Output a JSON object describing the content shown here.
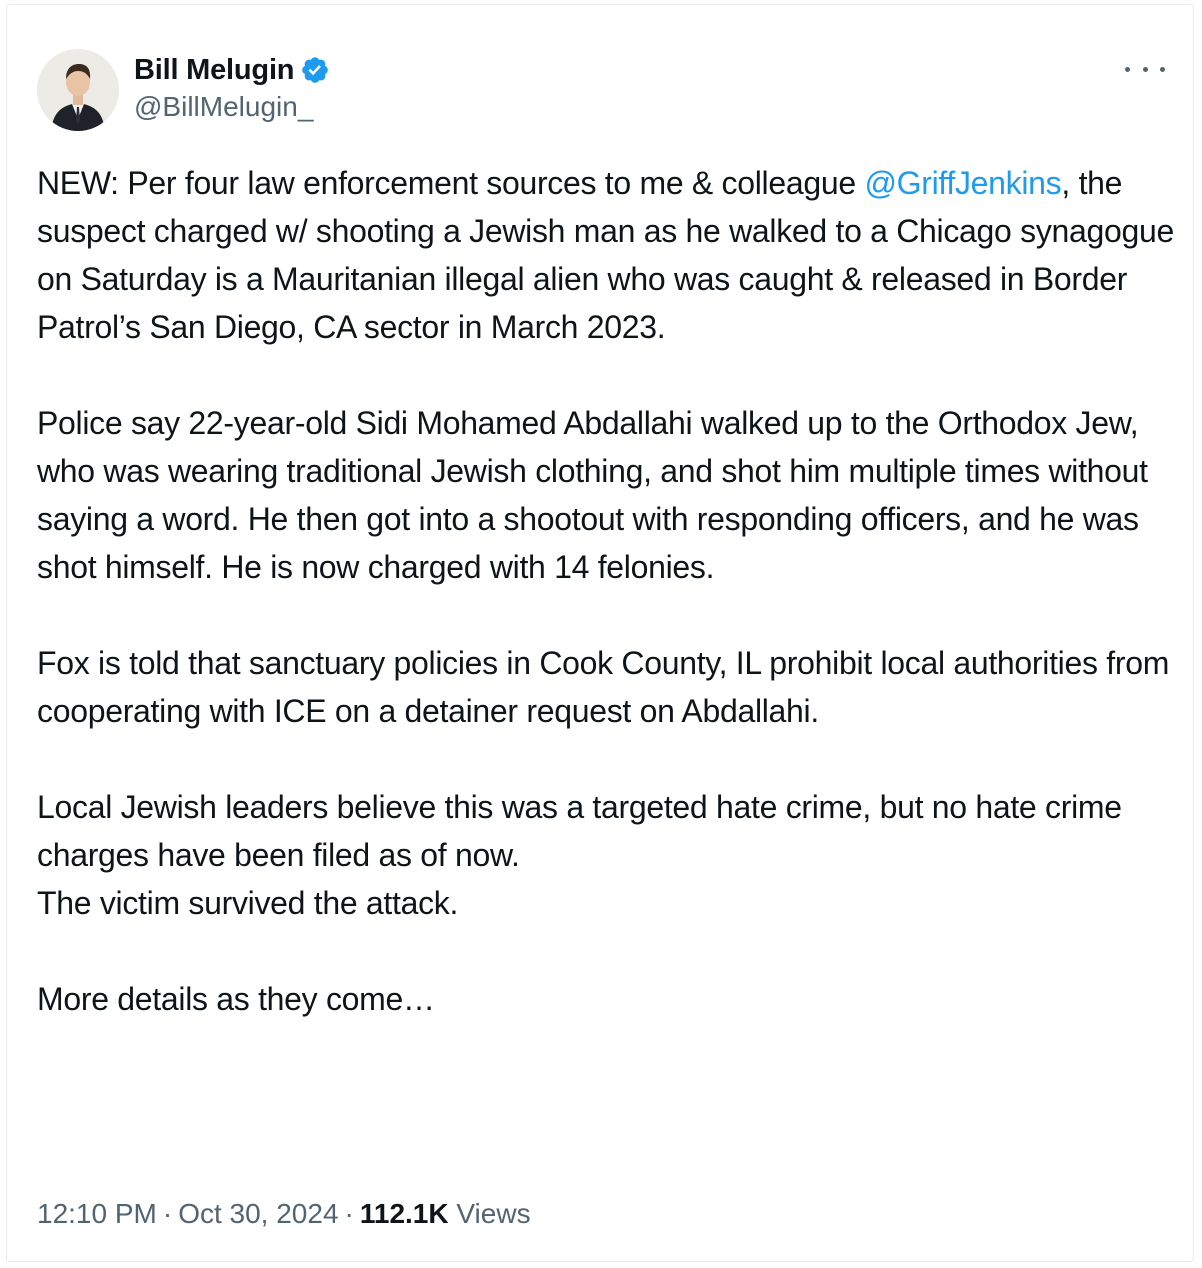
{
  "author": {
    "display_name": "Bill Melugin",
    "handle": "@BillMelugin_",
    "verified": true,
    "verified_color": "#1d9bf0"
  },
  "tweet": {
    "para1_pre": "NEW: Per four law enforcement sources to me & colleague ",
    "para1_mention": "@GriffJenkins",
    "para1_post": ", the suspect charged w/ shooting a Jewish man as he walked to a Chicago synagogue on Saturday is a Mauritanian illegal alien who was caught & released in Border Patrol’s San Diego, CA sector in March 2023.",
    "para2": "Police say 22-year-old Sidi Mohamed Abdallahi walked up to the Orthodox Jew, who was wearing traditional Jewish clothing, and shot him multiple times without saying a word. He then got into a shootout with responding officers, and he was shot himself. He is now charged with 14 felonies.",
    "para3": "Fox is told that sanctuary policies in Cook County, IL prohibit local authorities from cooperating with ICE on a detainer request on Abdallahi.",
    "para4_line1": "Local Jewish leaders believe this was a targeted hate crime, but no hate crime charges have been filed as of now.",
    "para4_line2": "The victim survived the attack.",
    "para5": "More details as they come…"
  },
  "meta": {
    "time": "12:10 PM",
    "date": "Oct 30, 2024",
    "separator": "·",
    "views_count": "112.1K",
    "views_label": "Views"
  },
  "colors": {
    "text": "#0f1419",
    "secondary": "#536471",
    "link": "#1d9bf0",
    "border": "#e6ebee"
  },
  "icons": {
    "more": "more-horizontal-icon",
    "verified": "verified-badge-icon"
  }
}
